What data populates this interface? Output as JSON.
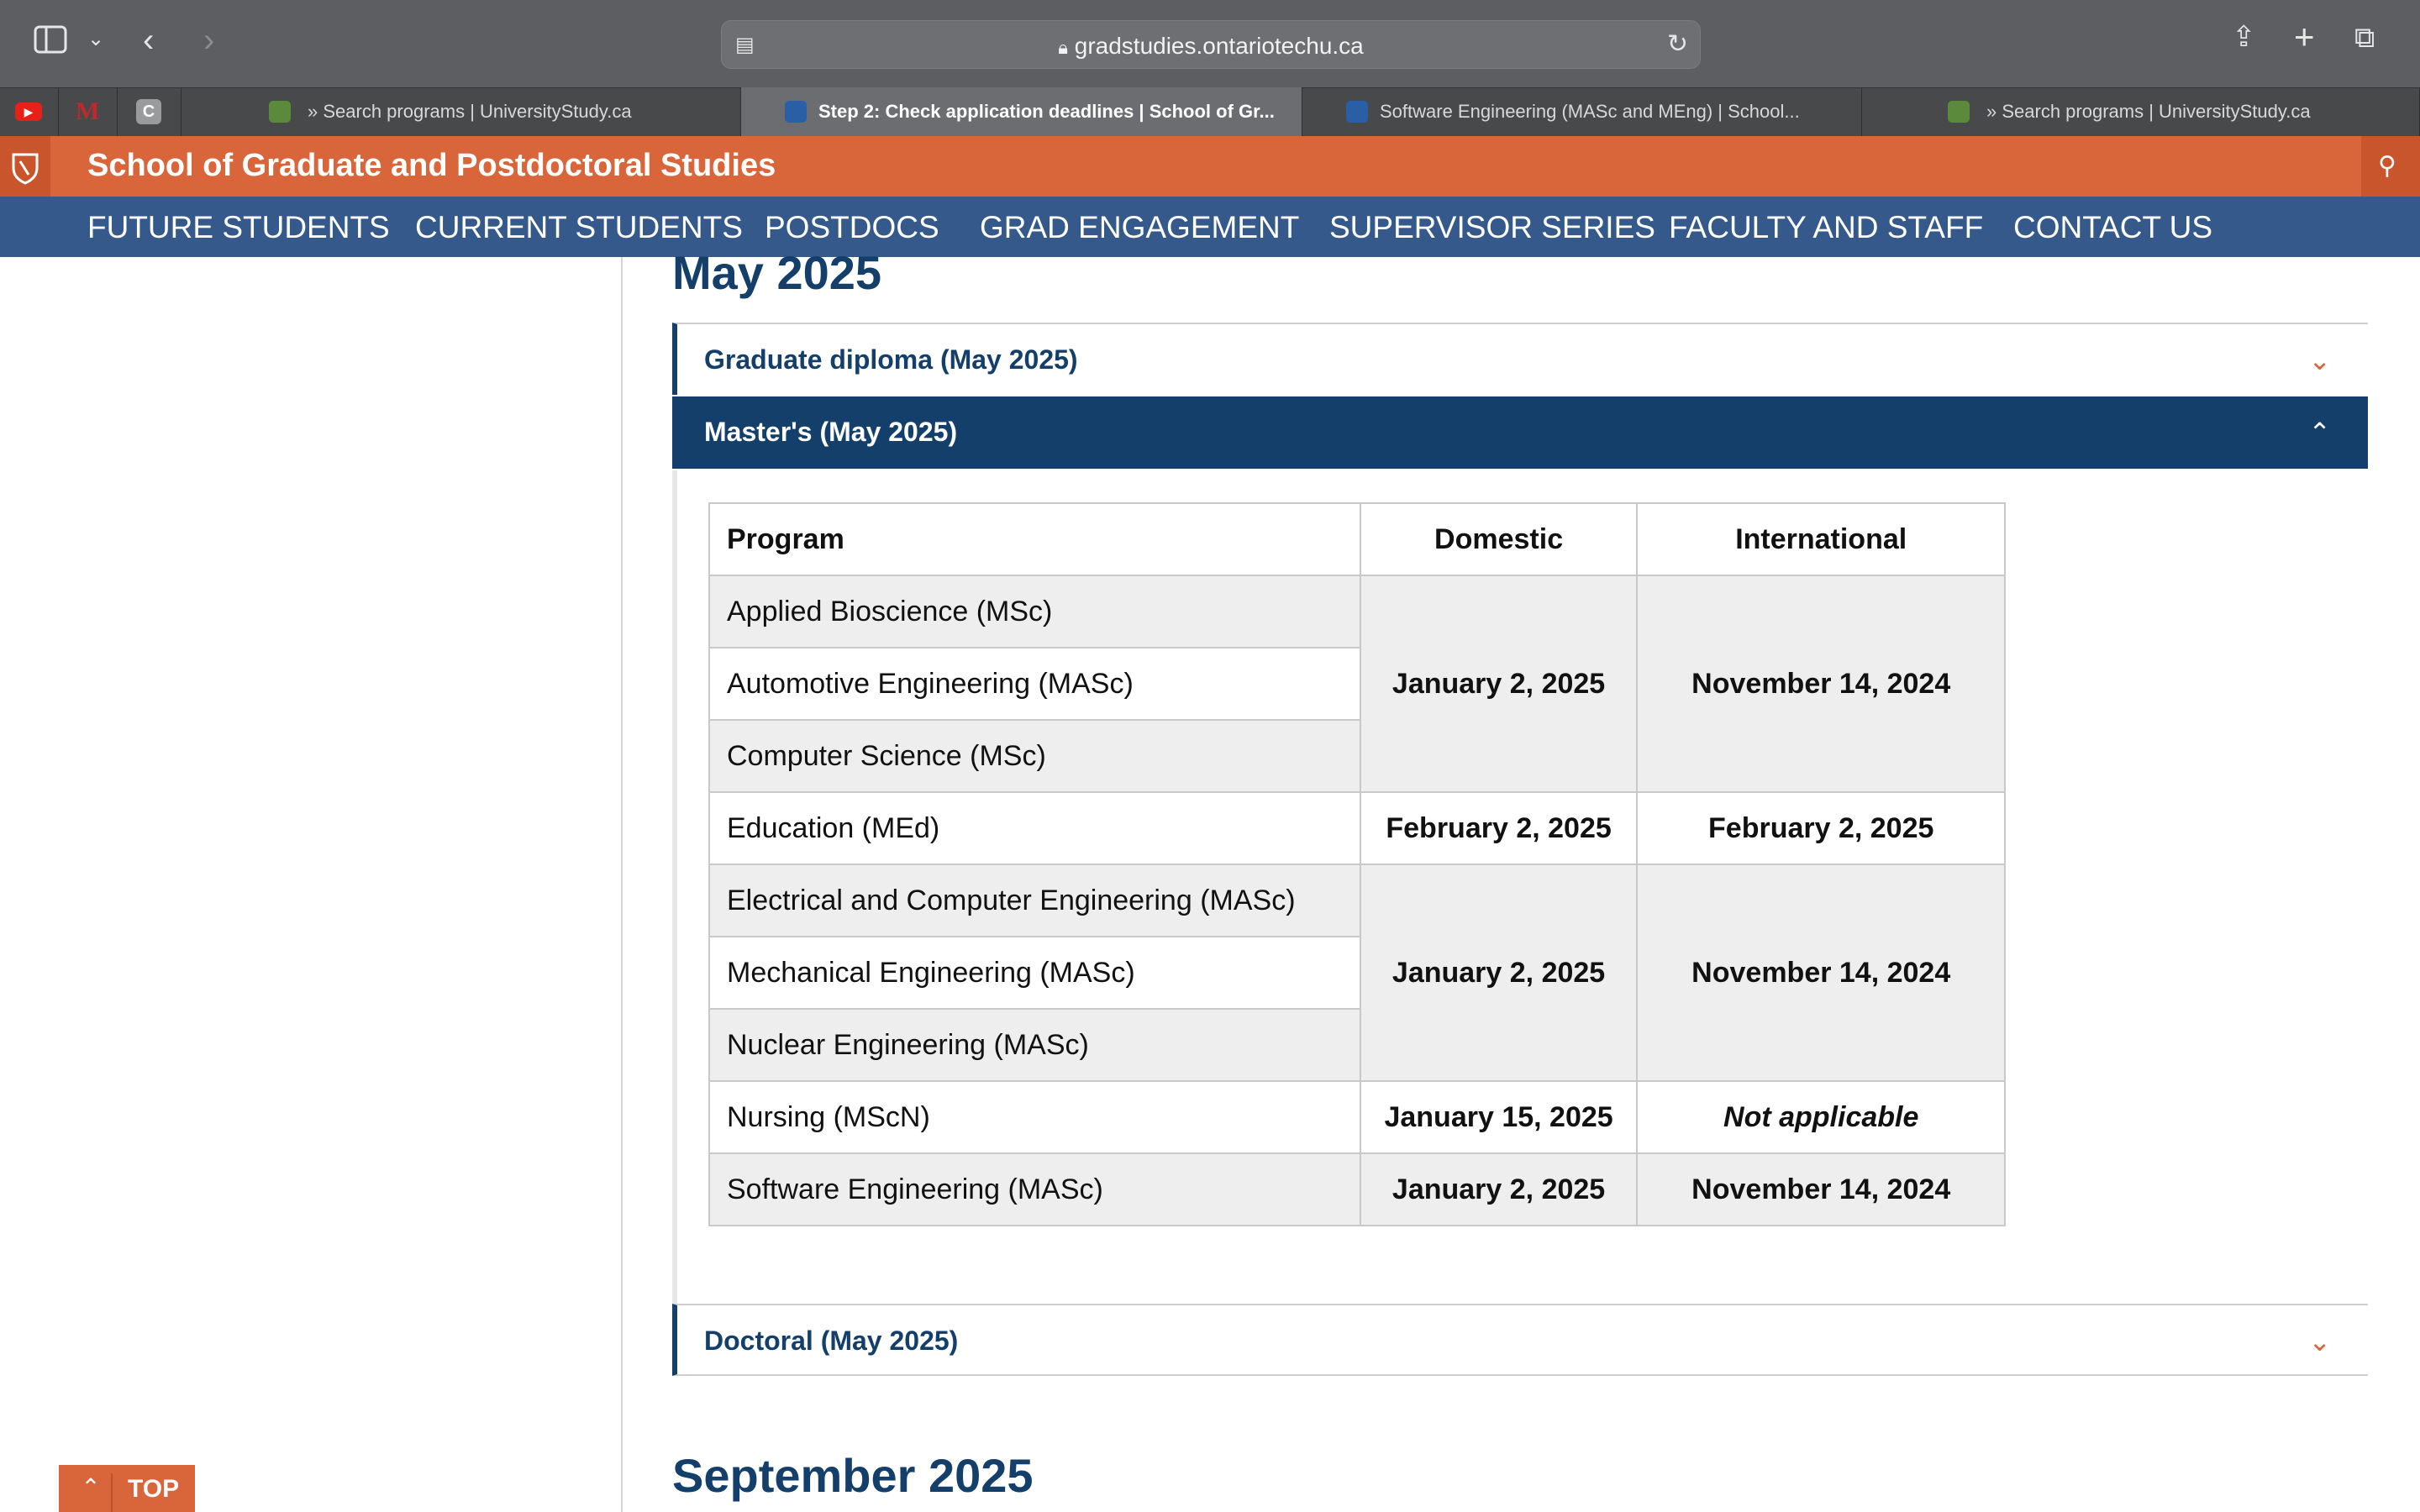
{
  "browser": {
    "url": "gradstudies.ontariotechu.ca",
    "tabs": [
      {
        "label": "» Search programs | UniversityStudy.ca",
        "active": false
      },
      {
        "label": "Step 2: Check application deadlines | School of Gr...",
        "active": true
      },
      {
        "label": "Software Engineering (MASc and MEng) | School...",
        "active": false
      },
      {
        "label": "» Search programs | UniversityStudy.ca",
        "active": false
      }
    ],
    "pinned_tabs": [
      "youtube-icon",
      "m-icon",
      "c-icon"
    ],
    "icons": {
      "sidebar": "sidebar-icon",
      "back": "chevron-left-icon",
      "forward": "chevron-right-icon",
      "share": "share-icon",
      "new_tab": "plus-icon",
      "tabs_overview": "tabs-icon",
      "reload": "reload-icon",
      "lock": "lock-icon",
      "reader": "reader-icon"
    }
  },
  "site": {
    "title": "School of Graduate and Postdoctoral Studies",
    "nav": [
      "FUTURE STUDENTS",
      "CURRENT STUDENTS",
      "POSTDOCS",
      "GRAD ENGAGEMENT",
      "SUPERVISOR SERIES",
      "FACULTY AND STAFF",
      "CONTACT US"
    ],
    "brand_colors": {
      "orange": "#d9653a",
      "navy": "#143f6b",
      "nav_blue": "#34598a"
    }
  },
  "content": {
    "month_heading": "May 2025",
    "accordions": {
      "graduate_diploma": "Graduate diploma (May 2025)",
      "masters": "Master's (May 2025)",
      "doctoral": "Doctoral (May 2025)"
    },
    "table": {
      "headers": {
        "program": "Program",
        "domestic": "Domestic",
        "international": "International"
      },
      "programs": [
        "Applied Bioscience (MSc)",
        "Automotive Engineering (MASc)",
        "Computer Science (MSc)",
        "Education (MEd)",
        "Electrical and Computer Engineering (MASc)",
        "Mechanical Engineering (MASc)",
        "Nuclear Engineering (MASc)",
        "Nursing (MScN)",
        "Software Engineering (MASc)"
      ],
      "deadlines": {
        "group1_domestic": "January 2, 2025",
        "group1_international": "November 14, 2024",
        "education_domestic": "February 2, 2025",
        "education_international": "February 2, 2025",
        "group2_domestic": "January 2, 2025",
        "group2_international": "November 14, 2024",
        "nursing_domestic": "January 15, 2025",
        "nursing_international": "Not applicable",
        "software_domestic": "January 2, 2025",
        "software_international": "November 14, 2024"
      }
    },
    "next_heading": "September 2025",
    "top_button": "TOP"
  }
}
